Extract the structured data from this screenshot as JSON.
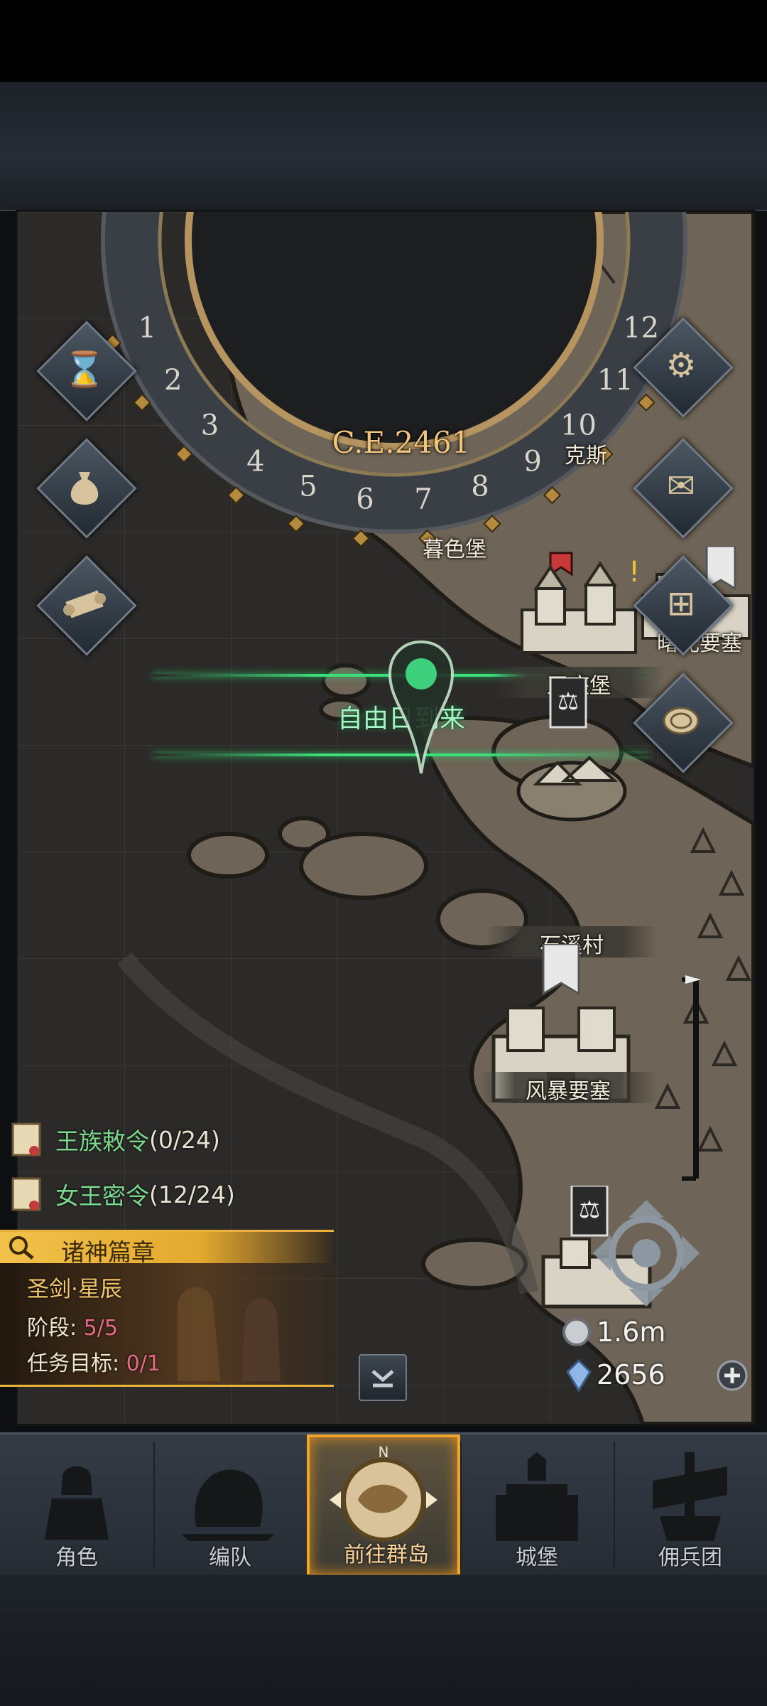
{
  "era": {
    "year_label": "C.E.2461",
    "month_numbers": [
      "1",
      "2",
      "3",
      "4",
      "5",
      "6",
      "7",
      "8",
      "9",
      "10",
      "11",
      "12"
    ]
  },
  "map": {
    "places": [
      {
        "name": "暮色堡"
      },
      {
        "name": "曙光要塞"
      },
      {
        "name": "王座堡"
      },
      {
        "name": "石溪村"
      },
      {
        "name": "风暴要塞"
      },
      {
        "name": "克斯"
      }
    ],
    "event_banner": "自由日到来"
  },
  "left_buttons": [
    {
      "icon": "hourglass-icon"
    },
    {
      "icon": "money-bag-icon"
    },
    {
      "icon": "scroll-icon"
    }
  ],
  "right_buttons": [
    {
      "icon": "gear-icon"
    },
    {
      "icon": "mail-icon"
    },
    {
      "icon": "grid-window-icon"
    },
    {
      "icon": "coin-icon"
    }
  ],
  "quests": [
    {
      "name": "王族敕令",
      "count": "(0/24)"
    },
    {
      "name": "女王密令",
      "count": "(12/24)"
    }
  ],
  "chapter": {
    "title": "诸神篇章",
    "subtitle": "圣剑·星辰",
    "stage_label": "阶段: ",
    "stage_value": "5/5",
    "goal_label": "任务目标: ",
    "goal_value": "0/1"
  },
  "resources": {
    "silver": "1.6m",
    "crystal": "2656"
  },
  "nav": [
    {
      "label": "角色"
    },
    {
      "label": "编队"
    },
    {
      "label": "前往群岛",
      "compass_letter": "N"
    },
    {
      "label": "城堡"
    },
    {
      "label": "佣兵团"
    }
  ],
  "colors": {
    "accent_gold": "#f0a42a",
    "quest_green": "#7ad98f",
    "banner_green": "#3bdf7b",
    "progress_pink": "#e46a8a"
  }
}
